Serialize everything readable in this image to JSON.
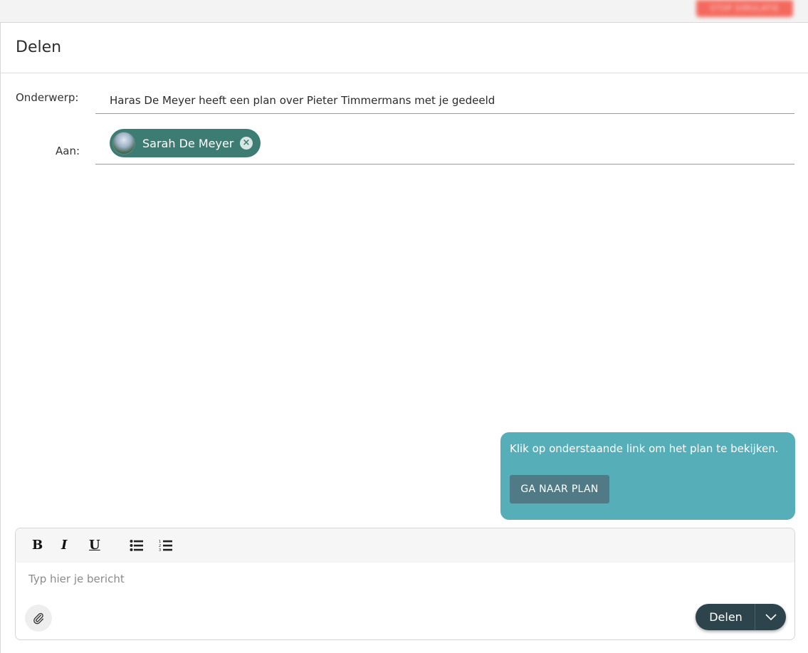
{
  "topbar": {
    "action_label": "STOP SIMULATIE"
  },
  "dialog": {
    "title": "Delen",
    "subject_label": "Onderwerp:",
    "subject_value": "Haras De Meyer heeft een plan over Pieter Timmermans met je gedeeld",
    "to_label": "Aan:",
    "recipients": [
      {
        "name": "Sarah De Meyer"
      }
    ]
  },
  "message": {
    "text": "Klik op onderstaande link om het plan te bekijken.",
    "button_label": "GA NAAR PLAN"
  },
  "editor": {
    "placeholder": "Typ hier je bericht",
    "toolbar": {
      "bold": "B",
      "italic": "I",
      "underline": "U"
    },
    "send_label": "Delen"
  },
  "colors": {
    "chip": "#3d7c73",
    "bubble": "#56aeb9",
    "plan_button": "#507a86",
    "send_button": "#2e444c",
    "top_action": "#f55a4e"
  },
  "icons": {
    "remove": "close-circle-icon",
    "bullet_list": "bullet-list-icon",
    "numbered_list": "numbered-list-icon",
    "attach": "paperclip-icon",
    "dropdown": "chevron-down-icon"
  }
}
